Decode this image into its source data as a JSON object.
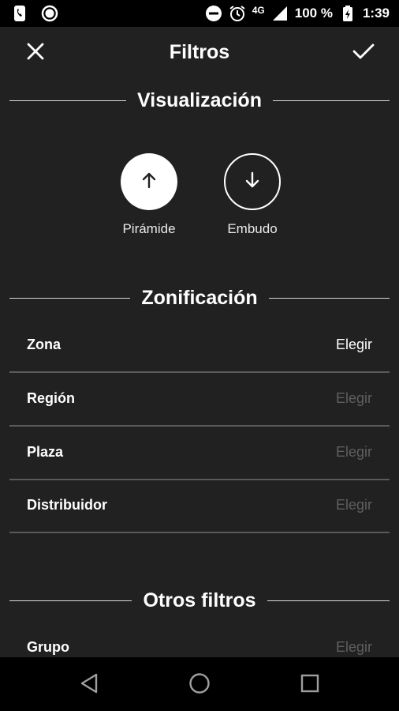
{
  "status_bar": {
    "network": "4G",
    "battery": "100 %",
    "time": "1:39",
    "icons": [
      "phone-icon",
      "record-icon",
      "do-not-disturb-icon",
      "alarm-icon",
      "signal-icon",
      "battery-charging-icon"
    ]
  },
  "header": {
    "title": "Filtros",
    "close_icon": "close-icon",
    "confirm_icon": "check-icon"
  },
  "visualization": {
    "title": "Visualización",
    "options": [
      {
        "label": "Pirámide",
        "icon": "arrow-up-icon",
        "selected": true
      },
      {
        "label": "Embudo",
        "icon": "arrow-down-icon",
        "selected": false
      }
    ]
  },
  "zoning": {
    "title": "Zonificación",
    "rows": [
      {
        "name": "Zona",
        "action": "Elegir",
        "enabled": true
      },
      {
        "name": "Región",
        "action": "Elegir",
        "enabled": false
      },
      {
        "name": "Plaza",
        "action": "Elegir",
        "enabled": false
      },
      {
        "name": "Distribuidor",
        "action": "Elegir",
        "enabled": false
      }
    ]
  },
  "other_filters": {
    "title": "Otros filtros",
    "rows": [
      {
        "name": "Grupo",
        "action": "Elegir",
        "enabled": false
      }
    ]
  },
  "colors": {
    "background": "#212121",
    "bars": "#000000",
    "text": "#ffffff",
    "disabled_text": "#5f5f5f",
    "divider": "#5a5a5a"
  },
  "nav_bar": {
    "icons": [
      "back-icon",
      "home-icon",
      "recents-icon"
    ]
  }
}
